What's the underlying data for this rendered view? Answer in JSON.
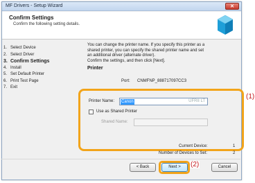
{
  "window": {
    "title": "MF Drivers - Setup Wizard",
    "close_glyph": "✕"
  },
  "header": {
    "title": "Confirm Settings",
    "subtitle": "Confirm the following setting details."
  },
  "steps": [
    {
      "num": "1.",
      "label": "Select Device"
    },
    {
      "num": "2.",
      "label": "Select Driver"
    },
    {
      "num": "3.",
      "label": "Confirm Settings"
    },
    {
      "num": "4.",
      "label": "Install"
    },
    {
      "num": "5.",
      "label": "Set Default Printer"
    },
    {
      "num": "6.",
      "label": "Print Test Page"
    },
    {
      "num": "7.",
      "label": "Exit"
    }
  ],
  "intro_lines": [
    "You can change the printer name. If you specify this printer as a",
    "shared printer, you can specify the shared printer name and set",
    "an additional driver (alternate driver).",
    "Confirm the settings, and then click [Next]."
  ],
  "printer_section": {
    "title": "Printer",
    "port_label": "Port:",
    "port_value": "CNMFNP_888717097CC3"
  },
  "printer_name": {
    "label": "Printer Name:",
    "value": "Canon",
    "tail": "UFRII LT"
  },
  "shared": {
    "checkbox_label": "Use as Shared Printer",
    "name_label": "Shared Name:",
    "name_value": ""
  },
  "status": {
    "current_label": "Current Device:",
    "current_value": "1",
    "total_label": "Number of Devices to Set:",
    "total_value": "2"
  },
  "buttons": {
    "back": "< Back",
    "next": "Next >",
    "cancel": "Cancel"
  },
  "callouts": {
    "one": "(1)",
    "two": "(2)"
  },
  "colors": {
    "highlight": "#f2a41a",
    "callout": "#c4161c",
    "selection": "#3399ff"
  }
}
